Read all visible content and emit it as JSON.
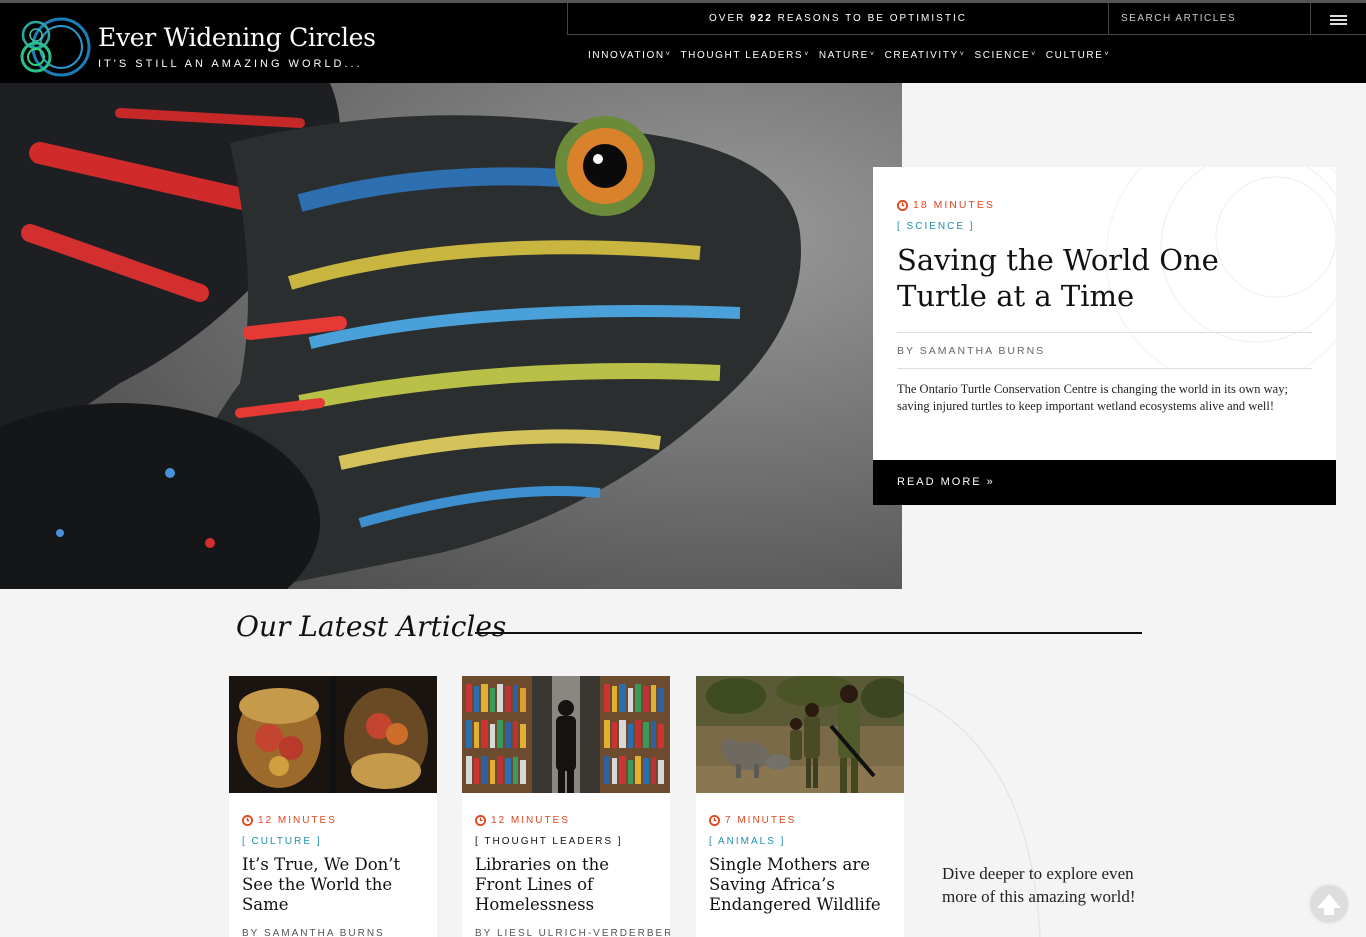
{
  "header": {
    "logo_title": "Ever Widening Circles",
    "logo_tagline": "IT'S STILL AN AMAZING WORLD...",
    "promo_prefix": "OVER",
    "promo_count": "922",
    "promo_suffix": "REASONS TO BE OPTIMISTIC",
    "search_placeholder": "SEARCH ARTICLES",
    "nav": [
      "INNOVATION",
      "THOUGHT LEADERS",
      "NATURE",
      "CREATIVITY",
      "SCIENCE",
      "CULTURE"
    ]
  },
  "hero": {
    "time": "18 MINUTES",
    "category": "[ SCIENCE ]",
    "title": "Saving the World One Turtle at a Time",
    "byline": "BY SAMANTHA BURNS",
    "description": "The Ontario Turtle Conservation Centre is changing the world in its own way; saving injured turtles to keep important wetland ecosystems alive and well!",
    "read_more": "READ MORE »"
  },
  "latest": {
    "heading": "Our Latest Articles",
    "articles": [
      {
        "time": "12 MINUTES",
        "category": "[ CULTURE ]",
        "title": "It’s True, We Don’t See the World the Same",
        "byline": "BY SAMANTHA BURNS"
      },
      {
        "time": "12 MINUTES",
        "category": "[ THOUGHT LEADERS ]",
        "title": "Libraries on the Front Lines of Homelessness",
        "byline": "BY LIESL ULRICH-VERDERBER"
      },
      {
        "time": "7 MINUTES",
        "category": "[ ANIMALS ]",
        "title": "Single Mothers are Saving Africa’s Endangered Wildlife",
        "byline": ""
      }
    ],
    "dive_text": "Dive deeper to explore even more of this amazing world!"
  },
  "colors": {
    "accent_orange": "#e0461e",
    "accent_blue": "#1e8fb0",
    "header_bg": "#000000"
  }
}
